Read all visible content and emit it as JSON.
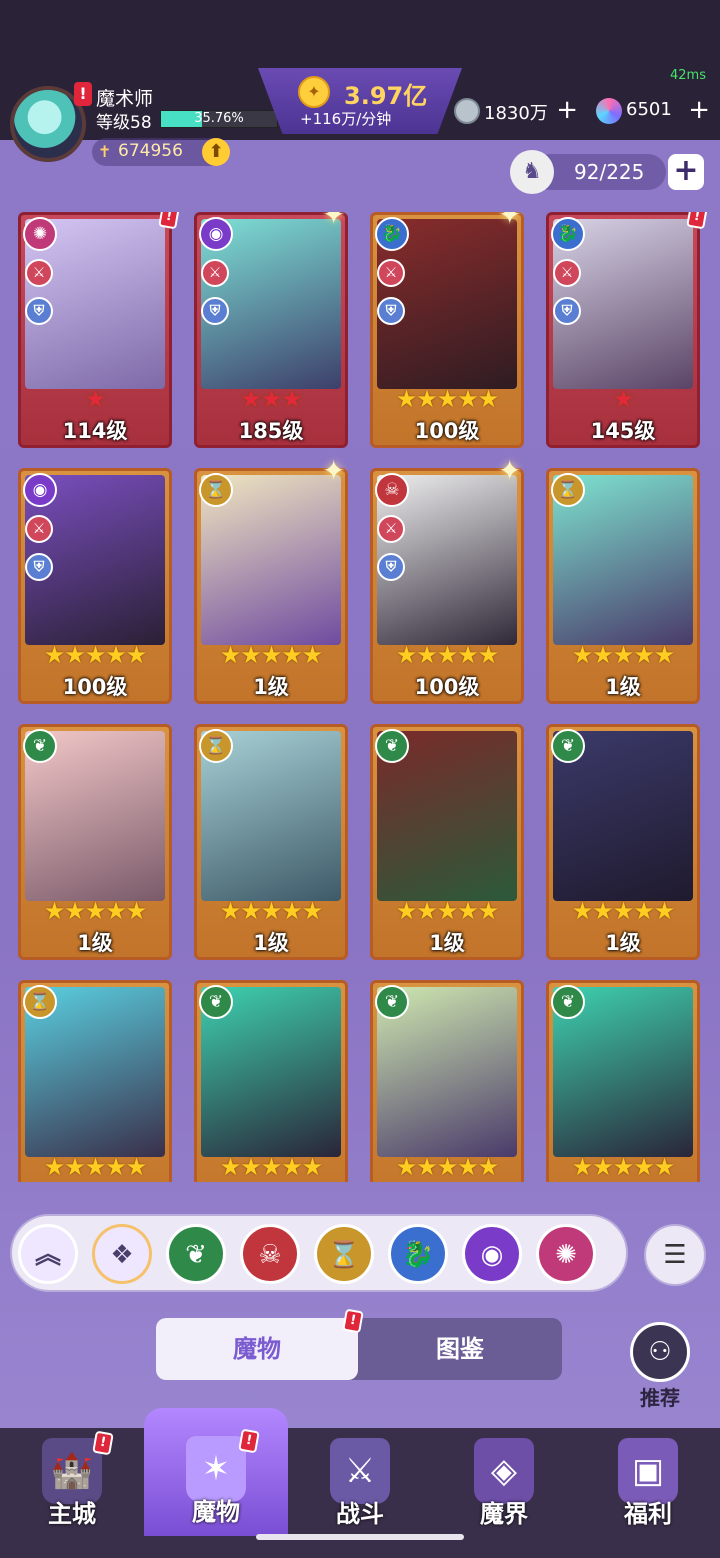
{
  "status": {
    "fps": "42ms"
  },
  "player": {
    "name": "魔术师",
    "level": "等级58",
    "xp_percent": "35.76%",
    "xp_fraction": 0.3576,
    "power": "674956"
  },
  "currency": {
    "gold_total": "3.97亿",
    "gold_rate": "+116万/分钟",
    "silver": "1830万",
    "gems": "6501"
  },
  "capacity": {
    "value": "92/225"
  },
  "colors": {
    "accent": "#7b5bd0",
    "gold": "#ffd460",
    "alert": "#e0263a"
  },
  "cards": [
    {
      "level": "114级",
      "stars": 1,
      "star_color": "red",
      "frame": "red",
      "faction": "spiral",
      "alert": true,
      "sparkle": false
    },
    {
      "level": "185级",
      "stars": 3,
      "star_color": "red",
      "frame": "red",
      "faction": "eye",
      "alert": false,
      "sparkle": true
    },
    {
      "level": "100级",
      "stars": 5,
      "star_color": "gold",
      "frame": "orange",
      "faction": "dragon",
      "alert": false,
      "sparkle": true
    },
    {
      "level": "145级",
      "stars": 1,
      "star_color": "red",
      "frame": "red",
      "faction": "dragon",
      "alert": true,
      "sparkle": false
    },
    {
      "level": "100级",
      "stars": 5,
      "star_color": "gold",
      "frame": "orange",
      "faction": "eye",
      "alert": false,
      "sparkle": false
    },
    {
      "level": "1级",
      "stars": 5,
      "star_color": "gold",
      "frame": "orange",
      "faction": "hourglass",
      "alert": false,
      "sparkle": true
    },
    {
      "level": "100级",
      "stars": 5,
      "star_color": "gold",
      "frame": "orange",
      "faction": "demon",
      "alert": false,
      "sparkle": true
    },
    {
      "level": "1级",
      "stars": 5,
      "star_color": "gold",
      "frame": "orange",
      "faction": "hourglass",
      "alert": false,
      "sparkle": false
    },
    {
      "level": "1级",
      "stars": 5,
      "star_color": "gold",
      "frame": "orange",
      "faction": "leaf",
      "alert": false,
      "sparkle": false
    },
    {
      "level": "1级",
      "stars": 5,
      "star_color": "gold",
      "frame": "orange",
      "faction": "hourglass",
      "alert": false,
      "sparkle": false
    },
    {
      "level": "1级",
      "stars": 5,
      "star_color": "gold",
      "frame": "orange",
      "faction": "leaf",
      "alert": false,
      "sparkle": false
    },
    {
      "level": "1级",
      "stars": 5,
      "star_color": "gold",
      "frame": "orange",
      "faction": "leaf",
      "alert": false,
      "sparkle": false
    },
    {
      "level": "",
      "stars": 5,
      "star_color": "gold",
      "frame": "orange",
      "faction": "hourglass",
      "alert": false,
      "sparkle": false
    },
    {
      "level": "",
      "stars": 5,
      "star_color": "gold",
      "frame": "orange",
      "faction": "leaf",
      "alert": false,
      "sparkle": false
    },
    {
      "level": "",
      "stars": 5,
      "star_color": "gold",
      "frame": "orange",
      "faction": "leaf",
      "alert": false,
      "sparkle": false
    },
    {
      "level": "",
      "stars": 5,
      "star_color": "gold",
      "frame": "orange",
      "faction": "leaf",
      "alert": false,
      "sparkle": false
    }
  ],
  "filters": [
    "collapse",
    "all",
    "leaf",
    "demon",
    "hourglass",
    "dragon",
    "eye",
    "spiral"
  ],
  "tabs": {
    "active": "魔物",
    "inactive": "图鉴"
  },
  "recommend": {
    "label": "推荐"
  },
  "nav": [
    {
      "label": "主城",
      "icon": "castle-icon"
    },
    {
      "label": "魔物",
      "icon": "flame-icon"
    },
    {
      "label": "战斗",
      "icon": "sword-icon"
    },
    {
      "label": "魔界",
      "icon": "portal-icon"
    },
    {
      "label": "福利",
      "icon": "chest-icon"
    }
  ]
}
